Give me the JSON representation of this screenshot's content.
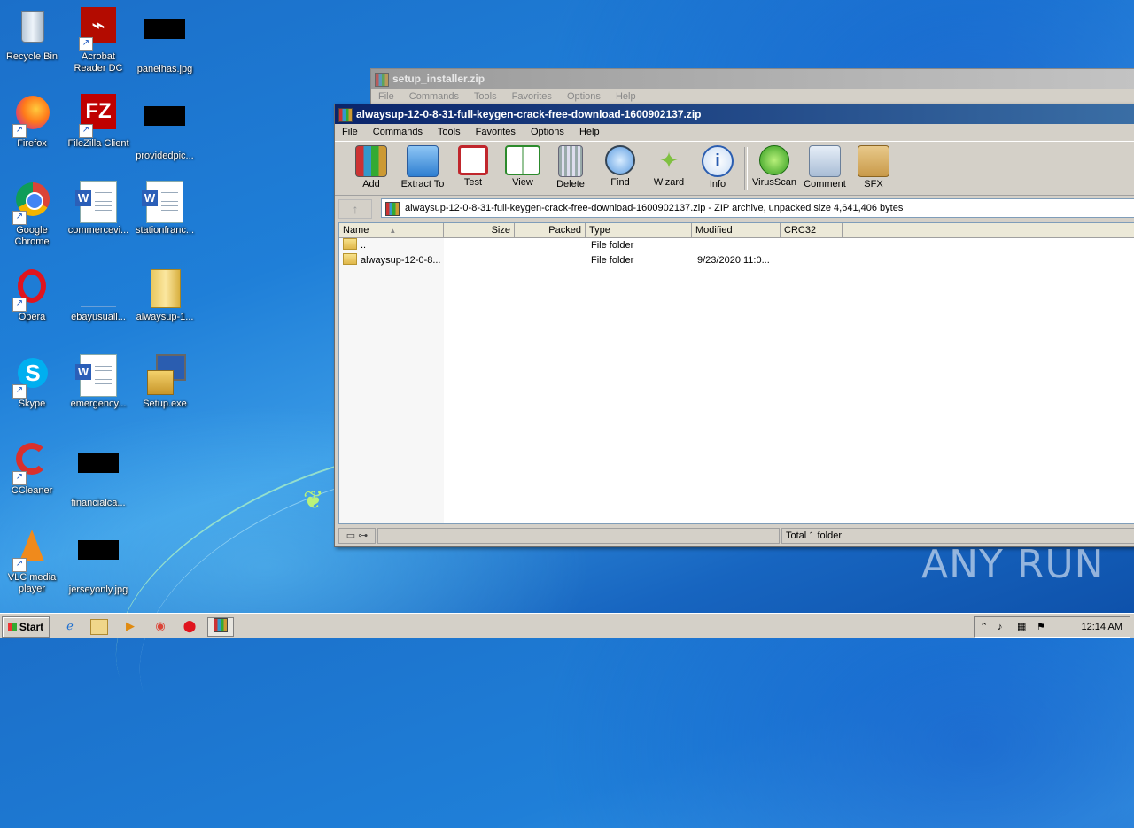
{
  "desktop": {
    "icons": [
      {
        "label": "Recycle Bin"
      },
      {
        "label": "Acrobat Reader DC"
      },
      {
        "label": "panelhas.jpg"
      },
      {
        "label": "Firefox"
      },
      {
        "label": "FileZilla Client"
      },
      {
        "label": "providedpic..."
      },
      {
        "label": "Google Chrome"
      },
      {
        "label": "commercevi..."
      },
      {
        "label": "stationfranc..."
      },
      {
        "label": "Opera"
      },
      {
        "label": "ebayusuall..."
      },
      {
        "label": "alwaysup-1..."
      },
      {
        "label": "Skype"
      },
      {
        "label": "emergency..."
      },
      {
        "label": "Setup.exe"
      },
      {
        "label": "CCleaner"
      },
      {
        "label": "financialca..."
      },
      {
        "label": "VLC media player"
      },
      {
        "label": "jerseyonly.jpg"
      }
    ]
  },
  "back_window": {
    "title": "setup_installer.zip",
    "menu": [
      "File",
      "Commands",
      "Tools",
      "Favorites",
      "Options",
      "Help"
    ]
  },
  "window": {
    "title": "alwaysup-12-0-8-31-full-keygen-crack-free-download-1600902137.zip",
    "menu": [
      "File",
      "Commands",
      "Tools",
      "Favorites",
      "Options",
      "Help"
    ],
    "toolbar": [
      {
        "label": "Add",
        "icon": "add-icon"
      },
      {
        "label": "Extract To",
        "icon": "extract-icon"
      },
      {
        "label": "Test",
        "icon": "test-icon"
      },
      {
        "label": "View",
        "icon": "view-icon"
      },
      {
        "label": "Delete",
        "icon": "delete-icon"
      },
      {
        "label": "Find",
        "icon": "find-icon"
      },
      {
        "label": "Wizard",
        "icon": "wizard-icon"
      },
      {
        "label": "Info",
        "icon": "info-icon"
      },
      {
        "label": "VirusScan",
        "icon": "virusscan-icon"
      },
      {
        "label": "Comment",
        "icon": "comment-icon"
      },
      {
        "label": "SFX",
        "icon": "sfx-icon"
      }
    ],
    "path_text": "alwaysup-12-0-8-31-full-keygen-crack-free-download-1600902137.zip - ZIP archive, unpacked size 4,641,406 bytes",
    "columns": [
      "Name",
      "Size",
      "Packed",
      "Type",
      "Modified",
      "CRC32"
    ],
    "rows": [
      {
        "name": "..",
        "size": "",
        "packed": "",
        "type": "File folder",
        "modified": "",
        "crc": ""
      },
      {
        "name": "alwaysup-12-0-8...",
        "size": "",
        "packed": "",
        "type": "File folder",
        "modified": "9/23/2020 11:0...",
        "crc": ""
      }
    ],
    "status_right": "Total 1 folder"
  },
  "watermark": "ANY RUN",
  "taskbar": {
    "start_label": "Start",
    "clock": "12:14 AM"
  }
}
